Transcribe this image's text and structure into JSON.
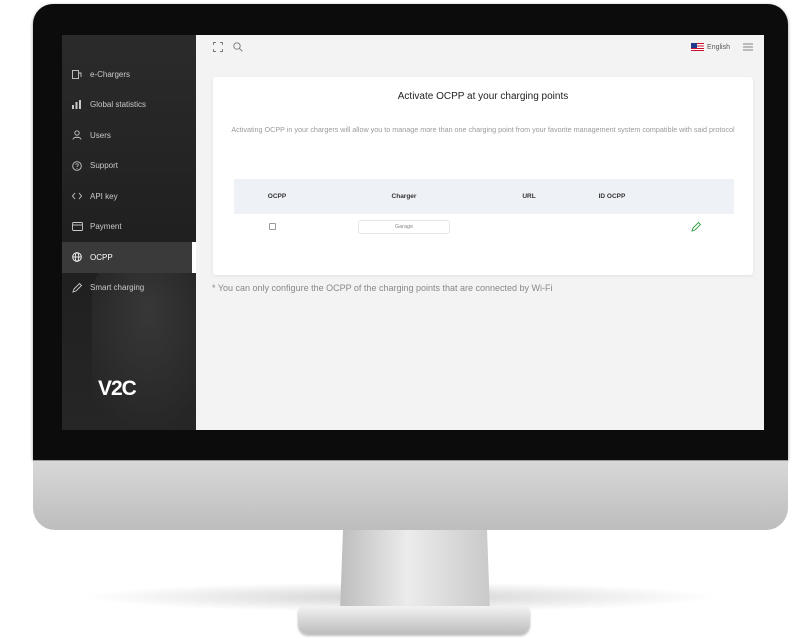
{
  "sidebar": {
    "items": [
      {
        "label": "e-Chargers",
        "icon": "charger-icon"
      },
      {
        "label": "Global statistics",
        "icon": "bar-chart-icon"
      },
      {
        "label": "Users",
        "icon": "user-icon"
      },
      {
        "label": "Support",
        "icon": "help-circle-icon"
      },
      {
        "label": "API key",
        "icon": "code-icon"
      },
      {
        "label": "Payment",
        "icon": "card-icon"
      },
      {
        "label": "OCPP",
        "icon": "globe-icon"
      },
      {
        "label": "Smart charging",
        "icon": "pencil-icon"
      }
    ],
    "active_item": "OCPP",
    "logo": "V2C"
  },
  "topbar": {
    "language": "English",
    "icons": [
      "fullscreen-icon",
      "search-icon",
      "flag-icon",
      "menu-icon"
    ]
  },
  "card": {
    "title": "Activate OCPP at your charging points",
    "description": "Activating OCPP in your chargers will allow you to manage more than one charging point from your favorite management system compatible with said protocol",
    "columns": [
      "OCPP",
      "Charger",
      "URL",
      "ID OCPP"
    ],
    "rows": [
      {
        "ocpp_checked": false,
        "charger": "Garage",
        "url": "",
        "id_ocpp": ""
      }
    ]
  },
  "note": "* You can only configure the OCPP of the charging points that are connected by Wi-Fi",
  "colors": {
    "sidebar_bg": "#242424",
    "accent_edit": "#2e9e3f",
    "table_header_bg": "#eef1f5"
  }
}
